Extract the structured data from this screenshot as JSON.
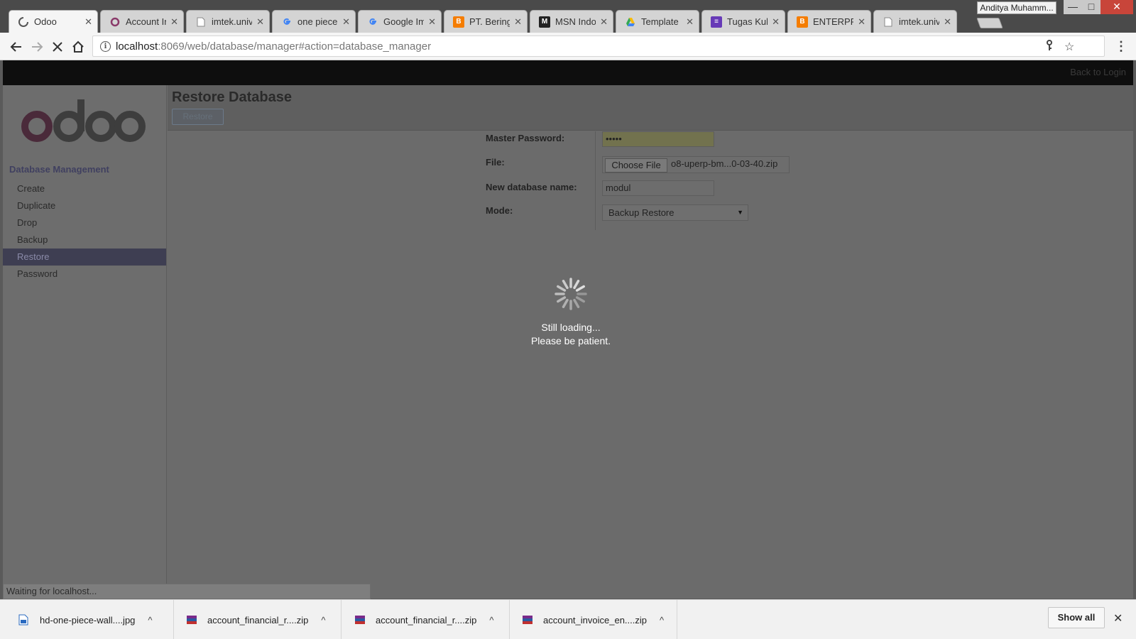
{
  "window": {
    "profile_name": "Anditya Muhamm...",
    "controls": {
      "minimize": "—",
      "maximize": "□",
      "close": "✕"
    }
  },
  "tabs": [
    {
      "title": "Odoo",
      "favicon": "loading-spinner-icon",
      "active": true
    },
    {
      "title": "Account Ir",
      "favicon": "odoo-circle-icon",
      "active": false
    },
    {
      "title": "imtek.univ",
      "favicon": "page-icon",
      "active": false
    },
    {
      "title": "one piece",
      "favicon": "google-icon",
      "active": false
    },
    {
      "title": "Google Im",
      "favicon": "google-icon",
      "active": false
    },
    {
      "title": "PT. Bering",
      "favicon": "blogger-icon",
      "active": false
    },
    {
      "title": "MSN Indor",
      "favicon": "msn-icon",
      "active": false
    },
    {
      "title": "Template",
      "favicon": "google-drive-icon",
      "active": false
    },
    {
      "title": "Tugas Kuli",
      "favicon": "forms-icon",
      "active": false
    },
    {
      "title": "ENTERPRIS",
      "favicon": "blogger-icon",
      "active": false
    },
    {
      "title": "imtek.univ",
      "favicon": "page-icon",
      "active": false
    }
  ],
  "toolbar": {
    "url_host": "localhost",
    "url_rest": ":8069/web/database/manager#action=database_manager"
  },
  "page": {
    "back_to_login": "Back to Login",
    "sidebar": {
      "title": "Database Management",
      "items": [
        {
          "label": "Create"
        },
        {
          "label": "Duplicate"
        },
        {
          "label": "Drop"
        },
        {
          "label": "Backup"
        },
        {
          "label": "Restore"
        },
        {
          "label": "Password"
        }
      ],
      "active_index": 4
    },
    "header": {
      "title": "Restore Database",
      "restore_button": "Restore"
    },
    "form": {
      "master_password_label": "Master Password:",
      "master_password_value": "•••••",
      "file_label": "File:",
      "choose_file_button": "Choose File",
      "file_name": "o8-uperp-bm...0-03-40.zip",
      "new_db_label": "New database name:",
      "new_db_value": "modul",
      "mode_label": "Mode:",
      "mode_value": "Backup Restore"
    },
    "loading": {
      "line1": "Still loading...",
      "line2": "Please be patient."
    }
  },
  "status_bar": "Waiting for localhost...",
  "downloads": {
    "items": [
      {
        "name": "hd-one-piece-wall....jpg",
        "icon": "image-file-icon"
      },
      {
        "name": "account_financial_r....zip",
        "icon": "winrar-archive-icon"
      },
      {
        "name": "account_financial_r....zip",
        "icon": "winrar-archive-icon"
      },
      {
        "name": "account_invoice_en....zip",
        "icon": "winrar-archive-icon"
      }
    ],
    "show_all": "Show all",
    "close": "✕"
  },
  "colors": {
    "overlay_gray": "#6b6b6b",
    "odoo_logo": "#4a2a3a",
    "active_sidebar": "#3e3e52",
    "window_close": "#c8453a"
  }
}
